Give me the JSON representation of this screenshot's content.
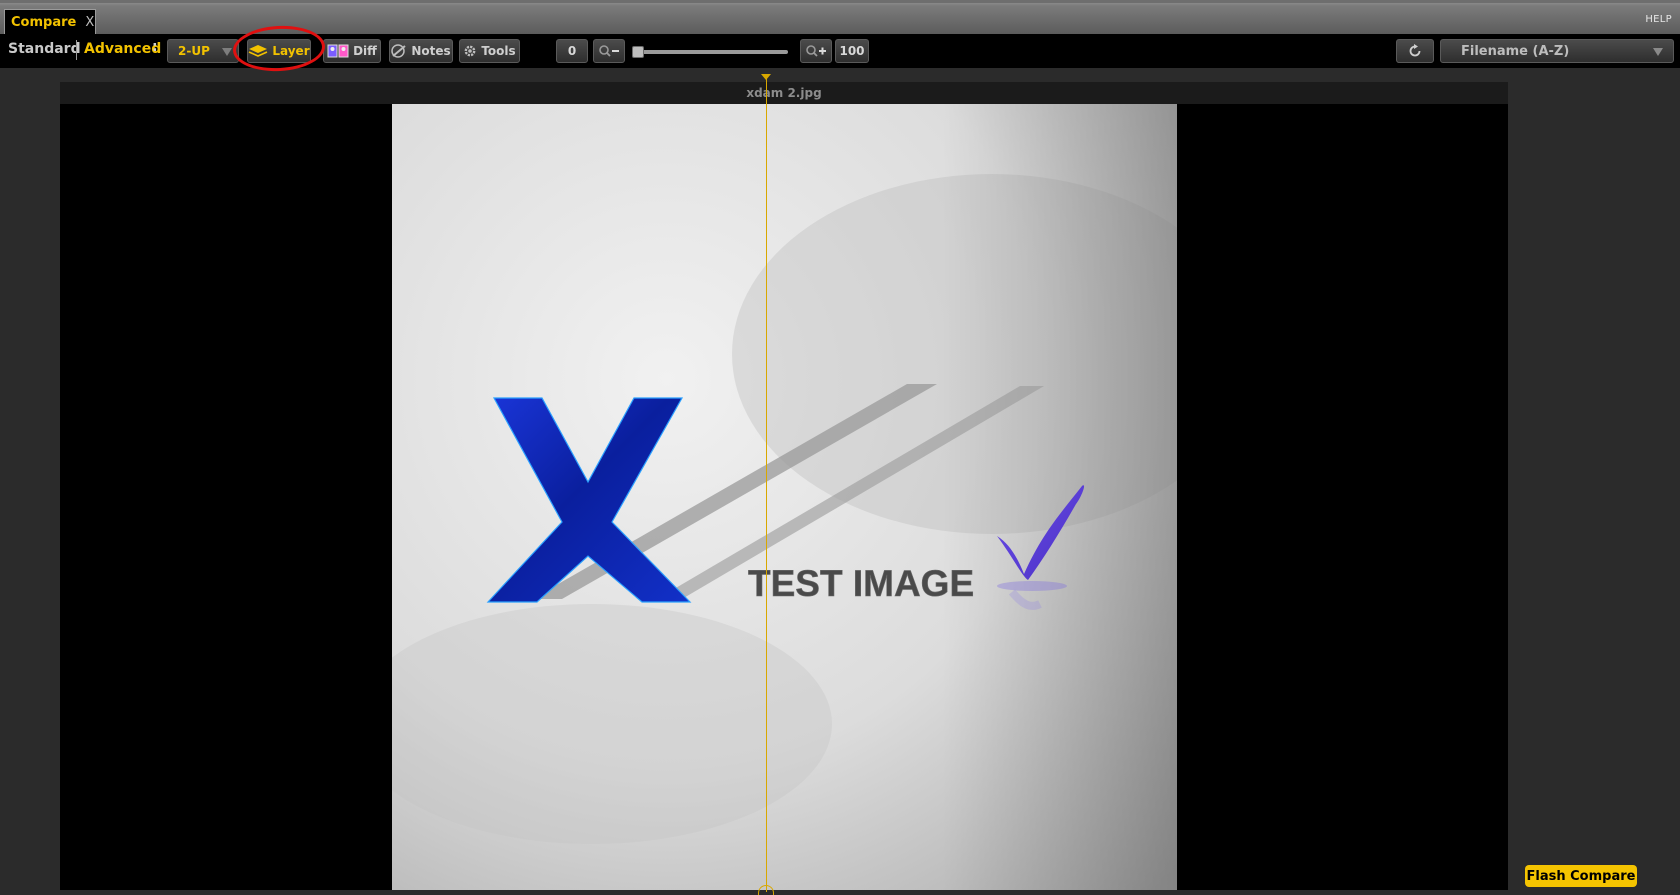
{
  "tab": {
    "label": "Compare",
    "close": "X"
  },
  "help": "HELP",
  "modes": {
    "standard": "Standard",
    "advanced": "Advanced",
    "separator": ":"
  },
  "toolbar": {
    "layout_select": "2-UP",
    "layer_label": "Layer",
    "diff_label": "Diff",
    "notes_label": "Notes",
    "tools_label": "Tools",
    "zoom_min": "0",
    "zoom_max": "100",
    "zoom_value_percent": 0,
    "sort_select": "Filename (A-Z)"
  },
  "viewer": {
    "image_title": "xdam 2.jpg",
    "image_text": "TEST IMAGE",
    "image_letter": "X",
    "split_position_percent": 48.3
  },
  "flash_compare": "Flash Compare",
  "colors": {
    "accent": "#f2c200",
    "annotation_ring": "#e01010",
    "split_line": "#d8a800",
    "logo_blue": "#0b22b5",
    "check_purple": "#5a3fd6"
  },
  "icons": {
    "layer": "layers-icon",
    "diff": "diff-icon",
    "notes": "notes-icon",
    "tools": "gear-icon",
    "zoom_out": "zoom-out-icon",
    "zoom_in": "zoom-in-icon",
    "refresh": "refresh-icon"
  }
}
